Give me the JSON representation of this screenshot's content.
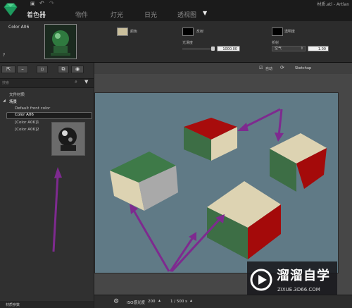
{
  "tabs": [
    {
      "label": "着色器",
      "active": true
    },
    {
      "label": "物件",
      "active": false
    },
    {
      "label": "灯光",
      "active": false
    },
    {
      "label": "日光",
      "active": false
    },
    {
      "label": "透视图",
      "active": false
    }
  ],
  "title": {
    "filename": "材质.atl - Artlan"
  },
  "material": {
    "name": "Color A06",
    "help": "?",
    "color_label": "颜色",
    "reflection_label": "反射",
    "transparency_label": "透明度",
    "glossiness_label": "光滑度",
    "glossiness_value": "1000.00",
    "refraction_label": "折射",
    "refraction_option": "空气",
    "refraction_value": "1.00"
  },
  "sidebar": {
    "search_placeholder": "搜索",
    "tree": {
      "root": "文件材质",
      "group": "场景",
      "items": [
        "Default front color",
        "Color A06",
        "[Color A06]1",
        "[Color A06]2"
      ]
    },
    "footer": "材质参数"
  },
  "viewport": {
    "auto_label": "自动",
    "app_label": "Sketchup",
    "iso_label": "ISO感光度",
    "iso_value": "200",
    "shutter_value": "1 / 500 s"
  },
  "watermark": {
    "title": "溜溜自学",
    "url": "ZIXUE.3D66.COM"
  },
  "colors": {
    "accent": "#7e2a8f",
    "cube_cream": "#ddd3b2",
    "cube_green": "#3d6e45",
    "cube_red": "#a40a0a",
    "canvas_bg": "#607a86"
  }
}
